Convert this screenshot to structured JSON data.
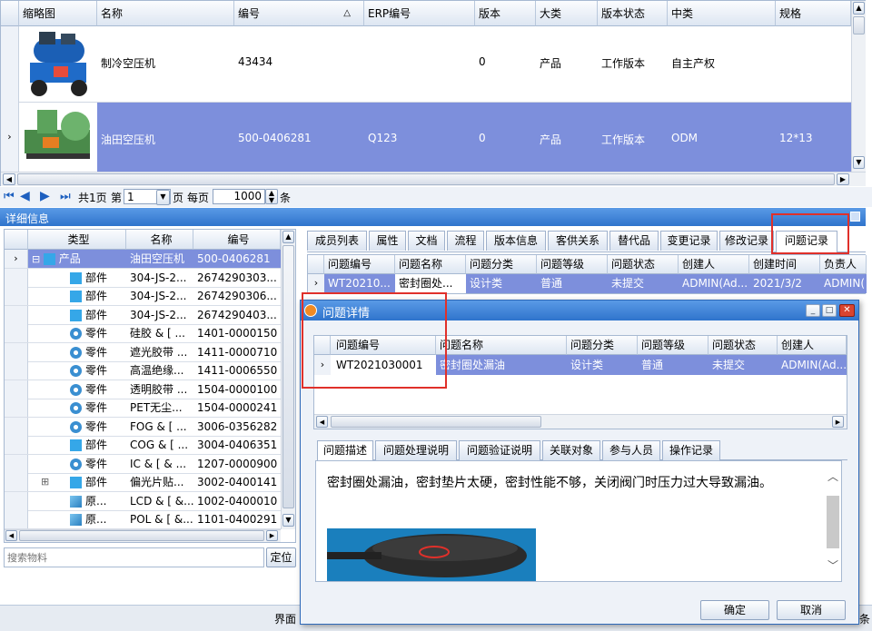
{
  "top_grid": {
    "columns": [
      "缩略图",
      "名称",
      "编号",
      "ERP编号",
      "版本",
      "大类",
      "版本状态",
      "中类",
      "规格"
    ],
    "sort_arrow": "△",
    "rows": [
      {
        "name": "制冷空压机",
        "code": "43434",
        "erp": "",
        "version": "0",
        "category": "产品",
        "status": "工作版本",
        "mid": "自主产权",
        "spec": ""
      },
      {
        "name": "油田空压机",
        "code": "500-0406281",
        "erp": "Q123",
        "version": "0",
        "category": "产品",
        "status": "工作版本",
        "mid": "ODM",
        "spec": "12*13"
      }
    ]
  },
  "pager": {
    "total": "共1页",
    "page_label": "第",
    "page_value": "1",
    "page_suffix": "页",
    "per_page_label": "每页",
    "per_page_value": "1000",
    "item_suffix": "条"
  },
  "detail_panel": {
    "title": "详细信息"
  },
  "tree": {
    "columns": [
      "类型",
      "名称",
      "编号"
    ],
    "rows": [
      {
        "type": "产品",
        "name": "油田空压机",
        "code": "500-0406281",
        "icon": "part"
      },
      {
        "type": "部件",
        "name": "304-JS-2...",
        "code": "2674290303...",
        "icon": "part"
      },
      {
        "type": "部件",
        "name": "304-JS-2...",
        "code": "2674290306...",
        "icon": "part"
      },
      {
        "type": "部件",
        "name": "304-JS-2...",
        "code": "2674290403...",
        "icon": "part"
      },
      {
        "type": "零件",
        "name": "硅胶 & [ ...",
        "code": "1401-0000150",
        "icon": "gear"
      },
      {
        "type": "零件",
        "name": "遮光胶带 ...",
        "code": "1411-0000710",
        "icon": "gear"
      },
      {
        "type": "零件",
        "name": "高温绝缘...",
        "code": "1411-0006550",
        "icon": "gear"
      },
      {
        "type": "零件",
        "name": "透明胶带 ...",
        "code": "1504-0000100",
        "icon": "gear"
      },
      {
        "type": "零件",
        "name": "PET无尘...",
        "code": "1504-0000241",
        "icon": "gear"
      },
      {
        "type": "零件",
        "name": "FOG & [ ...",
        "code": "3006-0356282",
        "icon": "gear"
      },
      {
        "type": "部件",
        "name": "COG & [ ...",
        "code": "3004-0406351",
        "icon": "part"
      },
      {
        "type": "零件",
        "name": "IC & [ & ...",
        "code": "1207-0000900",
        "icon": "gear"
      },
      {
        "type": "部件",
        "name": "偏光片贴...",
        "code": "3002-0400141",
        "icon": "part"
      },
      {
        "type": "原...",
        "name": "LCD & [ &...",
        "code": "1002-0400010",
        "icon": "raw"
      },
      {
        "type": "原...",
        "name": "POL & [ &...",
        "code": "1101-0400291",
        "icon": "raw"
      }
    ],
    "search_placeholder": "搜索物料",
    "locate_button": "定位"
  },
  "right_tabs": [
    "成员列表",
    "属性",
    "文档",
    "流程",
    "版本信息",
    "客供关系",
    "替代品",
    "变更记录",
    "修改记录",
    "问题记录"
  ],
  "issue_grid": {
    "columns": [
      "问题编号",
      "问题名称",
      "问题分类",
      "问题等级",
      "问题状态",
      "创建人",
      "创建时间",
      "负责人"
    ],
    "row": {
      "id": "WT20210...",
      "name": "密封圈处...",
      "category": "设计类",
      "level": "普通",
      "status": "未提交",
      "creator": "ADMIN(Ad...",
      "time": "2021/3/2",
      "owner": "ADMIN("
    }
  },
  "dialog": {
    "title": "问题详情",
    "columns": [
      "问题编号",
      "问题名称",
      "问题分类",
      "问题等级",
      "问题状态",
      "创建人"
    ],
    "row": {
      "id": "WT2021030001",
      "name": "密封圈处漏油",
      "category": "设计类",
      "level": "普通",
      "status": "未提交",
      "creator": "ADMIN(Ad..."
    },
    "tabs": [
      "问题描述",
      "问题处理说明",
      "问题验证说明",
      "关联对象",
      "参与人员",
      "操作记录"
    ],
    "description": "密封圈处漏油，密封垫片太硬，密封性能不够，关闭阀门时压力过大导致漏油。",
    "ok_button": "确定",
    "cancel_button": "取消"
  },
  "bottom_bar": {
    "partial_label": "界面",
    "partial_right": "条"
  },
  "colors": {
    "selected_row": "#7d8fdc",
    "title_bar": "#3e83d6",
    "highlight_box": "#e0302a"
  }
}
